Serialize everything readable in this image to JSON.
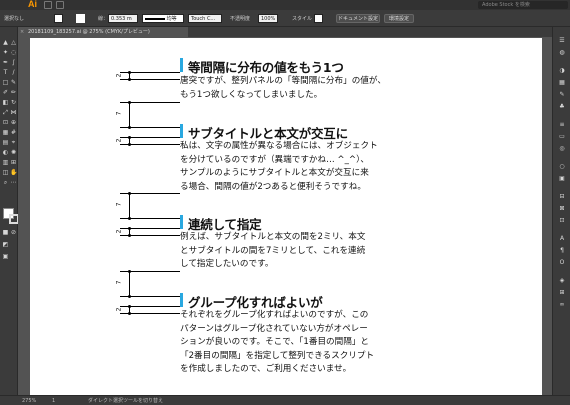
{
  "app": {
    "logo": "Ai",
    "search_placeholder": "Adobe Stock を検索"
  },
  "controlbar": {
    "selection_label": "選択なし",
    "stroke_label": "線：",
    "stroke_width": "0.353 m",
    "stroke_profile": "均等",
    "brush": "Touch C...",
    "opacity_label": "不透明度",
    "opacity_value": "100%",
    "style_label": "スタイル",
    "doc_setup_button": "ドキュメント設定",
    "prefs_button": "環境設定"
  },
  "tab": {
    "title": "20181109_183257.ai @ 275% (CMYK/プレビュー)",
    "close": "×"
  },
  "guides": [
    {
      "label": "2"
    },
    {
      "label": "7"
    },
    {
      "label": "2"
    },
    {
      "label": "7"
    },
    {
      "label": "2"
    },
    {
      "label": "7"
    },
    {
      "label": "2"
    }
  ],
  "sections": [
    {
      "title": "等間隔に分布の値をもう1つ",
      "body": [
        "唐突ですが、整列パネルの「等間隔に分布」の値が、",
        "もう1つ欲しくなってしまいました。"
      ]
    },
    {
      "title": "サブタイトルと本文が交互に",
      "body": [
        "私は、文字の属性が異なる場合には、オブジェクト",
        "を分けているのですが（異端ですかね… ^_^）、",
        "サンプルのようにサブタイトルと本文が交互に来",
        "る場合、間隔の値が2つあると便利そうですね。"
      ]
    },
    {
      "title": "連続して指定",
      "body": [
        "例えば、サブタイトルと本文の間を2ミリ、本文",
        "とサブタイトルの間を7ミリとして、これを連続",
        "して指定したいのです。"
      ]
    },
    {
      "title": "グループ化すればよいが",
      "body": [
        "それぞれをグループ化すればよいのですが、この",
        "パターンはグループ化されていない方がオペレー",
        "ションが良いのです。そこで、「1番目の間隔」と",
        "「2番目の間隔」を指定して整列できるスクリプト",
        "を作成しましたので、ご利用くださいませ。"
      ]
    }
  ],
  "status": {
    "zoom": "275%",
    "page": "1",
    "tool_hint": "ダイレクト選択ツールを切り替え"
  }
}
